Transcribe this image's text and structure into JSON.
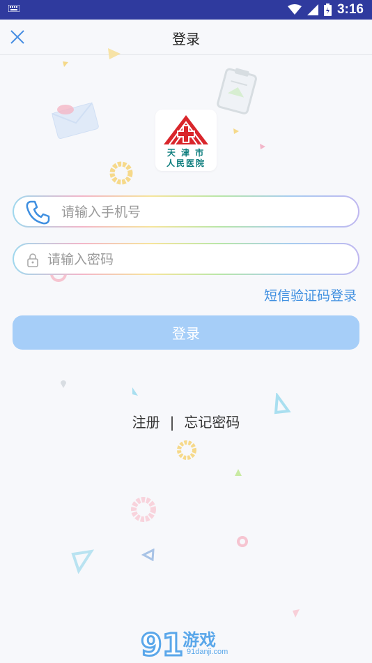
{
  "status_bar": {
    "time": "3:16"
  },
  "header": {
    "title": "登录"
  },
  "logo": {
    "line1": "天 津 市",
    "line2": "人民医院"
  },
  "form": {
    "phone_placeholder": "请输入手机号",
    "password_placeholder": "请输入密码",
    "sms_login_label": "短信验证码登录",
    "login_button_label": "登录"
  },
  "links": {
    "register": "注册",
    "separator": "|",
    "forgot_password": "忘记密码"
  },
  "watermark": {
    "brand": "游戏",
    "number": "91",
    "url": "91danji.com"
  },
  "colors": {
    "status_bar": "#2f3a9e",
    "accent": "#3f8fe0",
    "button": "#a6cef8",
    "logo_red": "#d9262b",
    "logo_text": "#0c7d7d"
  }
}
